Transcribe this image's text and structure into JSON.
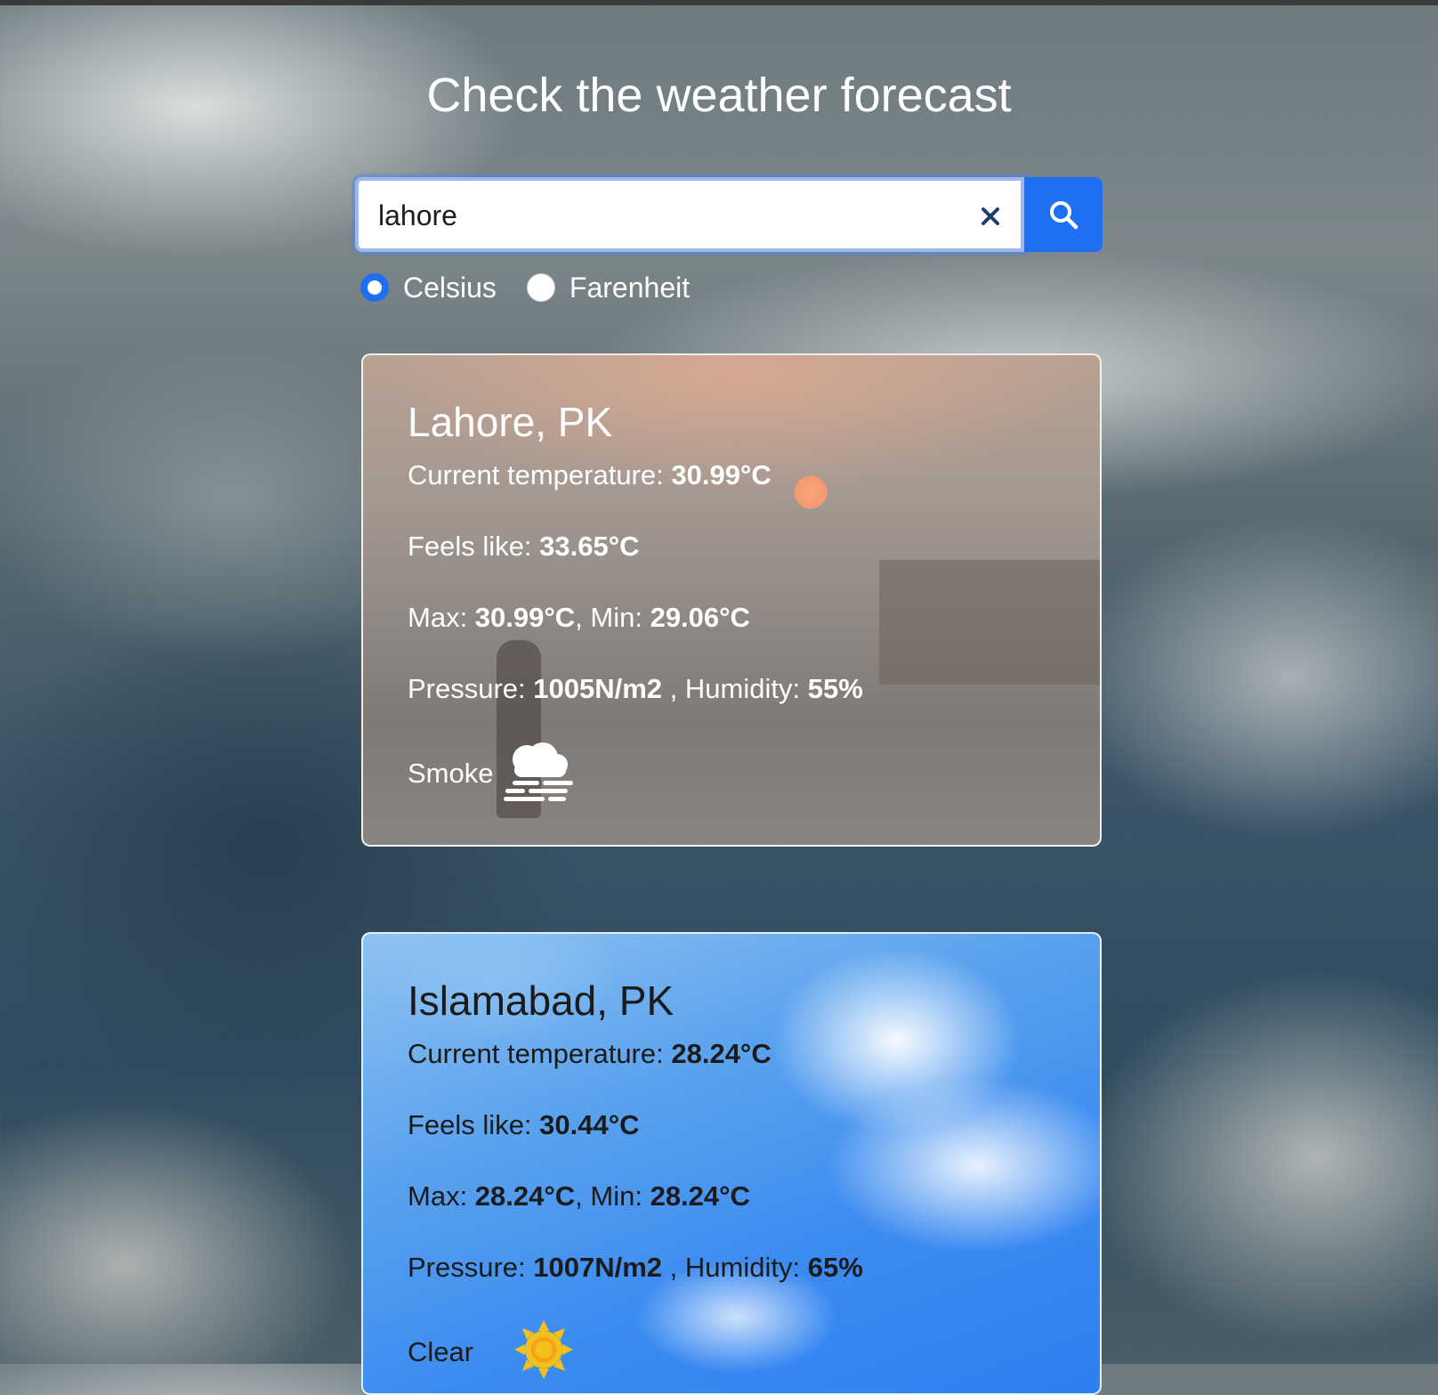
{
  "page": {
    "title": "Check the weather forecast"
  },
  "search": {
    "value": "lahore",
    "clear_icon": "close-icon",
    "button_icon": "search-icon"
  },
  "units": {
    "options": [
      {
        "label": "Celsius",
        "selected": true
      },
      {
        "label": "Farenheit",
        "selected": false
      }
    ]
  },
  "cards": [
    {
      "city": "Lahore, PK",
      "current_label": "Current temperature: ",
      "current_value": "30.99°C",
      "feels_label": "Feels like: ",
      "feels_value": "33.65°C",
      "max_label": "Max: ",
      "max_value": "30.99°C",
      "min_label": ", Min: ",
      "min_value": "29.06°C",
      "pressure_label": "Pressure: ",
      "pressure_value": "1005N/m2",
      "humidity_label": " , Humidity: ",
      "humidity_value": "55%",
      "condition": "Smoke",
      "condition_icon": "smoke-fog-icon"
    },
    {
      "city": "Islamabad, PK",
      "current_label": "Current temperature: ",
      "current_value": "28.24°C",
      "feels_label": "Feels like: ",
      "feels_value": "30.44°C",
      "max_label": "Max: ",
      "max_value": "28.24°C",
      "min_label": ", Min: ",
      "min_value": "28.24°C",
      "pressure_label": "Pressure: ",
      "pressure_value": "1007N/m2",
      "humidity_label": " , Humidity: ",
      "humidity_value": "65%",
      "condition": "Clear",
      "condition_icon": "sun-icon"
    }
  ],
  "colors": {
    "accent": "#1f6ff2",
    "sun": "#f2c21b"
  }
}
